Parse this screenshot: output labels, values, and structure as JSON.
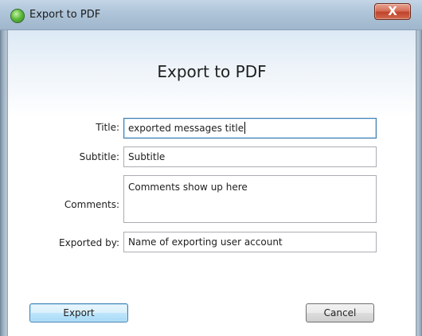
{
  "window": {
    "title": "Export to PDF",
    "close_glyph": "X",
    "app_icon": "green-orb-icon"
  },
  "dialog": {
    "heading": "Export to PDF"
  },
  "form": {
    "title_label": "Title:",
    "title_value": "exported messages title",
    "subtitle_label": "Subtitle:",
    "subtitle_value": "Subtitle",
    "comments_label": "Comments:",
    "comments_value": "Comments show up here",
    "exported_by_label": "Exported by:",
    "exported_by_value": "Name of exporting user account"
  },
  "buttons": {
    "export_label": "Export",
    "cancel_label": "Cancel"
  },
  "colors": {
    "title_bar": "#aec4d8",
    "close_button": "#c1432b",
    "focus_border": "#3d7bad",
    "default_button": "#bee6fd"
  }
}
